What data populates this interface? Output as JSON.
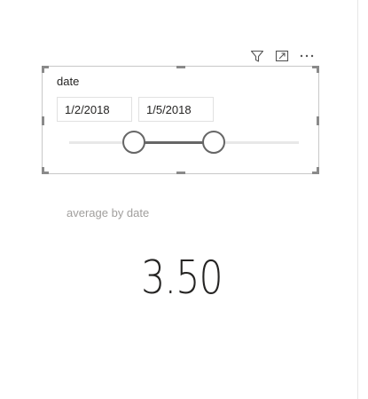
{
  "visual_header": {
    "icons": [
      "filter-icon",
      "focus-mode-icon",
      "more-options-icon"
    ]
  },
  "slicer": {
    "title": "date",
    "start_date": "1/2/2018",
    "end_date": "1/5/2018",
    "range_start_fraction": 0.28,
    "range_end_fraction": 0.63
  },
  "card": {
    "label": "average by date",
    "value": "3.50"
  },
  "colors": {
    "accent": "#666666",
    "track": "#e8e8e8",
    "label_gray": "#a19f9d",
    "text": "#252423"
  }
}
